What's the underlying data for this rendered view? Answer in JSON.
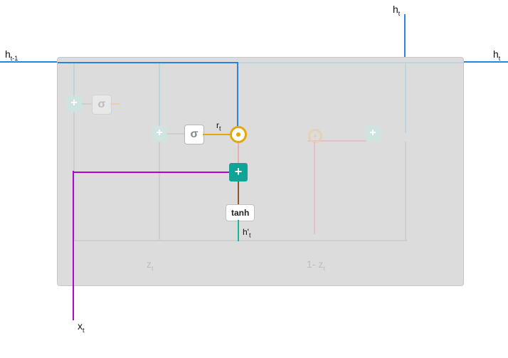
{
  "labels": {
    "h_prev": "h",
    "h_prev_sub": "t-1",
    "h_top": "h",
    "h_top_sub": "t",
    "h_right": "h",
    "h_right_sub": "t",
    "x_in": "x",
    "x_in_sub": "t",
    "r": "r",
    "r_sub": "t",
    "h_cand": "h'",
    "h_cand_sub": "t",
    "sigma": "σ",
    "sigma_fade1": "σ",
    "plus_fade": "+",
    "plus": "+",
    "tanh": "tanh",
    "z": "z",
    "z_sub": "t",
    "one_minus_z": "1- z",
    "one_minus_z_sub": "t"
  }
}
